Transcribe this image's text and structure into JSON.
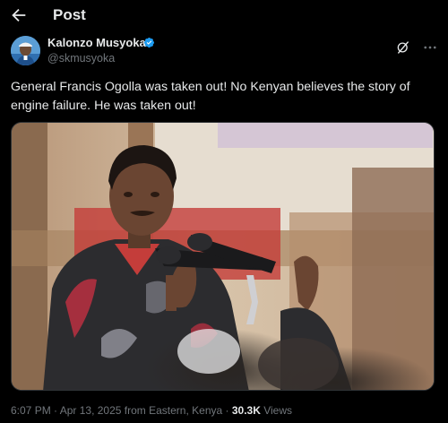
{
  "header": {
    "title": "Post",
    "back_icon": "arrow-left-icon"
  },
  "author": {
    "display_name": "Kalonzo Musyoka",
    "handle": "@skmusyoka",
    "verified": true,
    "verified_color": "#1d9bf0"
  },
  "tweet": {
    "text": "General Francis Ogolla was taken out! No Kenyan believes the story of engine failure. He was taken out!"
  },
  "meta": {
    "time": "6:07 PM",
    "separator": " · ",
    "date": "Apr 13, 2025",
    "location": "from Eastern, Kenya",
    "views_count": "30.3K",
    "views_label": "Views"
  },
  "colors": {
    "background": "#000000",
    "text_primary": "#e7e9ea",
    "text_secondary": "#71767b"
  }
}
